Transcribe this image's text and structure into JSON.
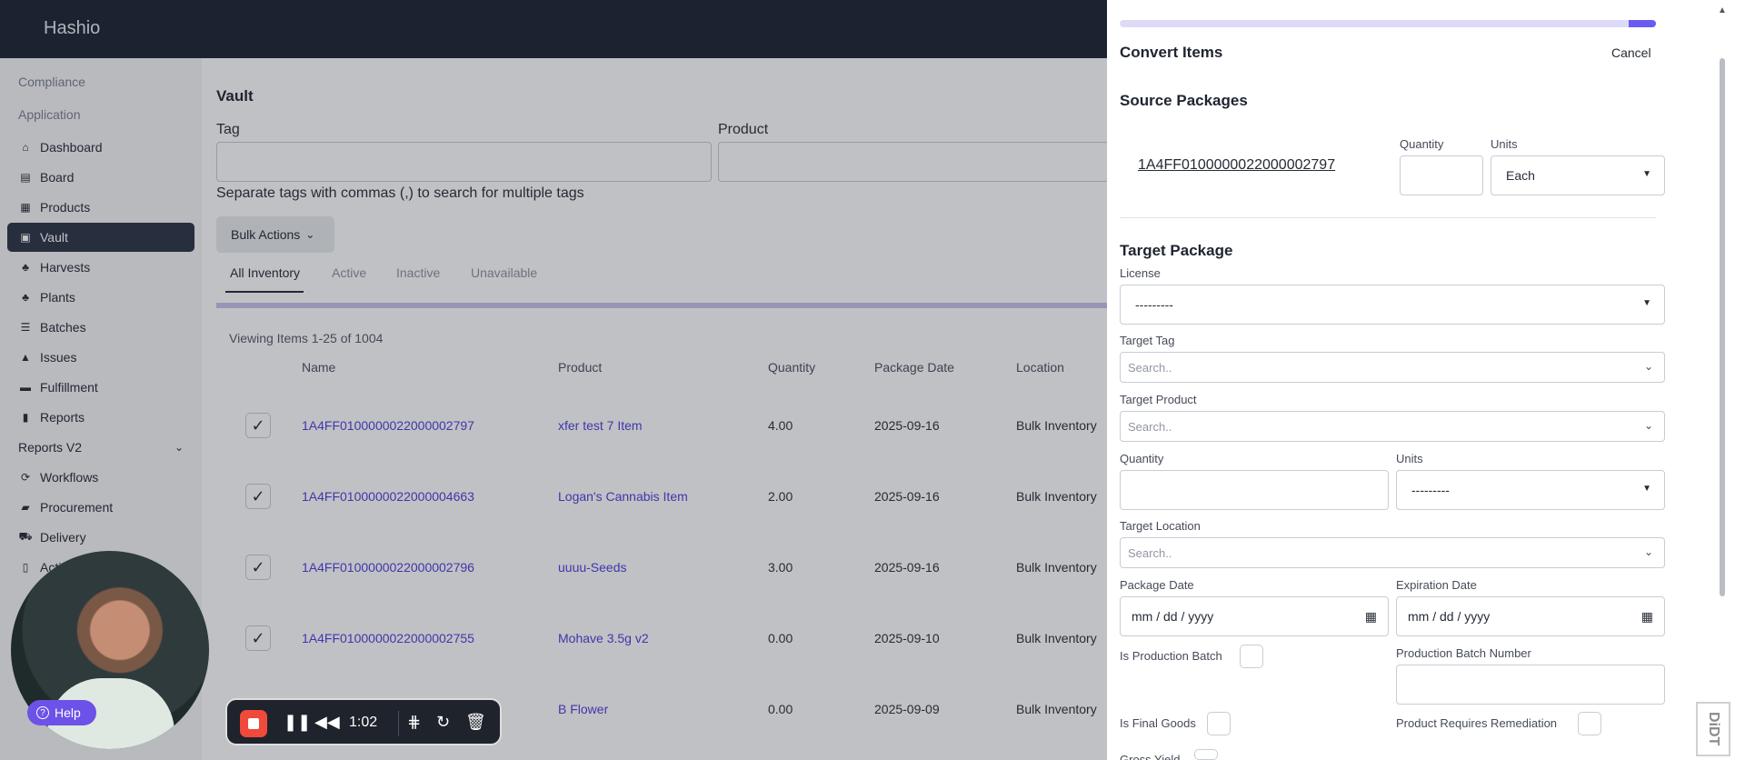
{
  "app": {
    "brand": "Hashio"
  },
  "sidebar": {
    "sections": [
      "Compliance",
      "Application"
    ],
    "items": [
      {
        "label": "Dashboard",
        "icon": "home-icon"
      },
      {
        "label": "Board",
        "icon": "board-icon"
      },
      {
        "label": "Products",
        "icon": "products-icon"
      },
      {
        "label": "Vault",
        "icon": "vault-icon",
        "active": true
      },
      {
        "label": "Harvests",
        "icon": "harvest-icon"
      },
      {
        "label": "Plants",
        "icon": "plant-icon"
      },
      {
        "label": "Batches",
        "icon": "batches-icon"
      },
      {
        "label": "Issues",
        "icon": "warning-icon"
      },
      {
        "label": "Fulfillment",
        "icon": "fulfillment-icon"
      },
      {
        "label": "Reports",
        "icon": "chart-icon"
      },
      {
        "label": "Reports V2",
        "icon": "",
        "expandable": true
      },
      {
        "label": "Workflows",
        "icon": "workflow-icon"
      },
      {
        "label": "Procurement",
        "icon": "procurement-icon"
      },
      {
        "label": "Delivery",
        "icon": "truck-icon"
      },
      {
        "label": "Acti",
        "icon": "activity-icon"
      }
    ]
  },
  "main": {
    "title": "Vault",
    "tag_label": "Tag",
    "product_label": "Product",
    "hint": "Separate tags with commas (,) to search for multiple tags",
    "bulk_actions": "Bulk Actions",
    "tabs": [
      "All Inventory",
      "Active",
      "Inactive",
      "Unavailable"
    ],
    "viewing": "Viewing Items 1-25 of 1004",
    "columns": [
      "Name",
      "Product",
      "Quantity",
      "Package Date",
      "Location"
    ],
    "rows": [
      {
        "checked": true,
        "name": "1A4FF0100000022000002797",
        "product": "xfer test 7 Item",
        "quantity": "4.00",
        "date": "2025-09-16",
        "location": "Bulk Inventory"
      },
      {
        "checked": true,
        "name": "1A4FF0100000022000004663",
        "product": "Logan's Cannabis Item",
        "quantity": "2.00",
        "date": "2025-09-16",
        "location": "Bulk Inventory"
      },
      {
        "checked": true,
        "name": "1A4FF0100000022000002796",
        "product": "uuuu-Seeds",
        "quantity": "3.00",
        "date": "2025-09-16",
        "location": "Bulk Inventory"
      },
      {
        "checked": true,
        "name": "1A4FF0100000022000002755",
        "product": "Mohave 3.5g v2",
        "quantity": "0.00",
        "date": "2025-09-10",
        "location": "Bulk Inventory"
      },
      {
        "checked": false,
        "name": "",
        "product": "B Flower",
        "quantity": "0.00",
        "date": "2025-09-09",
        "location": "Bulk Inventory"
      }
    ]
  },
  "drawer": {
    "progress": 0.95,
    "title": "Convert Items",
    "cancel": "Cancel",
    "source_heading": "Source Packages",
    "source_tag": "1A4FF0100000022000002797",
    "quantity_label": "Quantity",
    "units_label": "Units",
    "source_units": "Each",
    "target_heading": "Target Package",
    "license_label": "License",
    "license_value": "---------",
    "target_tag_label": "Target Tag",
    "target_product_label": "Target Product",
    "search_placeholder": "Search..",
    "units_value": "---------",
    "target_location_label": "Target Location",
    "package_date_label": "Package Date",
    "expiration_date_label": "Expiration Date",
    "date_placeholder": "mm / dd / yyyy",
    "is_production_batch": "Is Production Batch",
    "production_batch_number": "Production Batch Number",
    "is_final_goods": "Is Final Goods",
    "product_requires_remediation": "Product Requires Remediation",
    "gross_yield": "Gross Yield"
  },
  "recorder": {
    "time": "1:02",
    "help": "Help"
  },
  "watermark": "DiDT",
  "colors": {
    "accent": "#6a5cf0",
    "link": "#4c3fe0",
    "topbar": "#1c2433",
    "record": "#ef4a3c"
  }
}
